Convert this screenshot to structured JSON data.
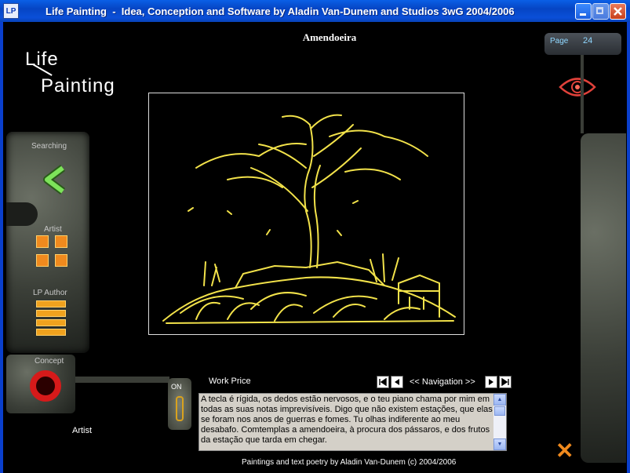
{
  "window": {
    "icon_text": "LP",
    "title": "Life Painting  -  Idea, Conception and Software by Aladin Van-Dunem and Studios 3wG 2004/2006"
  },
  "logo": {
    "line1": "Life",
    "line2": "Painting"
  },
  "page": {
    "label": "Page",
    "number": "24"
  },
  "painting": {
    "title": "Amendoeira"
  },
  "sidebar": {
    "searching_label": "Searching",
    "artist_label": "Artist",
    "lp_author_label": "LP Author",
    "concept_label": "Concept"
  },
  "switch": {
    "label": "ON"
  },
  "work_price_label": "Work Price",
  "navigation": {
    "label": "<< Navigation >>"
  },
  "poem_text": "A tecla é rígida, os dedos estão nervosos, e o teu piano chama por mim em todas as suas notas imprevisíveis. Digo que não existem estações, que elas se foram nos anos de guerras e fomes. Tu olhas indiferente ao meu desabafo. Comtemplas a amendoeira, à procura dos pássaros, e dos frutos da estação que tarda em chegar.",
  "artist_bottom_label": "Artist",
  "footer": "Paintings and text poetry by Aladin Van-Dunem (c) 2004/2006",
  "colors": {
    "accent_orange": "#f08a1e",
    "title_blue": "#0a4fd8",
    "painting_yellow": "#f2e24a"
  }
}
